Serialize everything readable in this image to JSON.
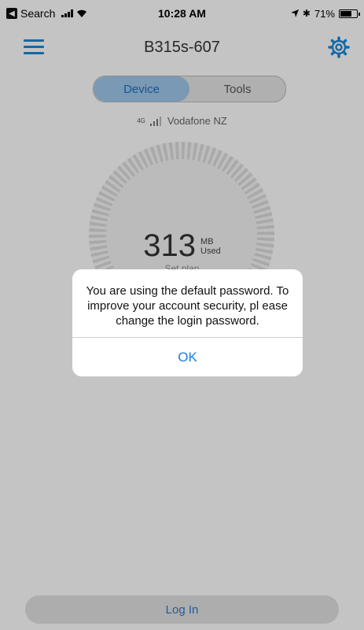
{
  "status_bar": {
    "back_label": "Search",
    "time": "10:28 AM",
    "battery": "71%",
    "battery_level": 0.71
  },
  "header": {
    "title": "B315s-607"
  },
  "tabs": [
    {
      "label": "Device",
      "active": true
    },
    {
      "label": "Tools",
      "active": false
    }
  ],
  "network": {
    "type_badge": "4G",
    "carrier": "Vodafone NZ"
  },
  "usage": {
    "value": "313",
    "unit_top": "MB",
    "unit_bottom": "Used",
    "plan_label": "Set plan"
  },
  "dialog": {
    "message": "You are using the default password. To improve your account security, pl ease change the login password.",
    "ok_label": "OK"
  },
  "footer": {
    "login_label": "Log In"
  },
  "colors": {
    "accent": "#1d88d6",
    "dialog_button": "#1a7fe0"
  },
  "icons": [
    "menu-icon",
    "gear-icon",
    "signal-icon",
    "wifi-icon",
    "location-icon",
    "bluetooth-icon",
    "battery-icon"
  ]
}
